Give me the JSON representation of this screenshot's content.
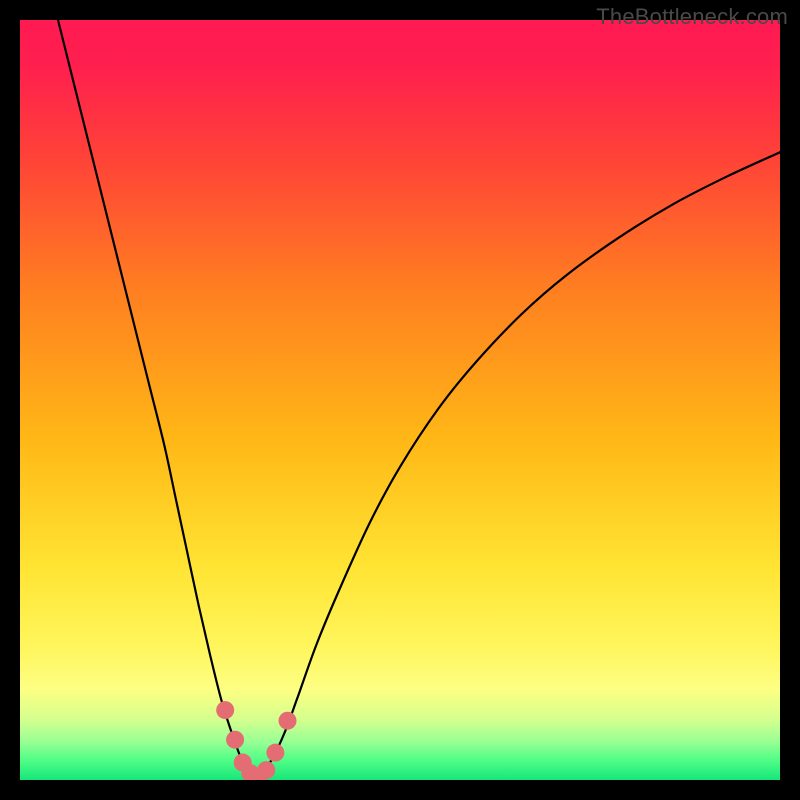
{
  "watermark": {
    "text": "TheBottleneck.com"
  },
  "chart_data": {
    "type": "line",
    "title": "",
    "xlabel": "",
    "ylabel": "",
    "xlim": [
      0,
      100
    ],
    "ylim": [
      0,
      100
    ],
    "grid": false,
    "legend": false,
    "background_gradient": {
      "stops": [
        {
          "pos": 0.0,
          "color": "#ff1a52"
        },
        {
          "pos": 0.06,
          "color": "#ff1f4f"
        },
        {
          "pos": 0.18,
          "color": "#ff4238"
        },
        {
          "pos": 0.35,
          "color": "#ff7d21"
        },
        {
          "pos": 0.55,
          "color": "#ffb716"
        },
        {
          "pos": 0.72,
          "color": "#ffe433"
        },
        {
          "pos": 0.82,
          "color": "#fff55a"
        },
        {
          "pos": 0.88,
          "color": "#fdff82"
        },
        {
          "pos": 0.92,
          "color": "#d5ff8e"
        },
        {
          "pos": 0.95,
          "color": "#97ff94"
        },
        {
          "pos": 0.975,
          "color": "#4dfd86"
        },
        {
          "pos": 1.0,
          "color": "#17e67a"
        }
      ]
    },
    "series": [
      {
        "name": "bottleneck-curve",
        "color": "#000000",
        "width": 2.2,
        "x": [
          5,
          7,
          9,
          11,
          13,
          15,
          17,
          19,
          20.5,
          22,
          23.5,
          25,
          26.5,
          28,
          29.2,
          30.2,
          31,
          31.8,
          33.2,
          34.8,
          36.5,
          39,
          42,
          46,
          50,
          55,
          60,
          66,
          72,
          79,
          86,
          93,
          100
        ],
        "y": [
          100,
          92,
          84,
          76,
          68,
          60,
          52,
          44,
          37,
          30,
          23,
          16.5,
          10.5,
          5.8,
          2.6,
          0.9,
          0.35,
          0.9,
          2.8,
          6.2,
          10.8,
          17.8,
          25,
          33.8,
          41.2,
          48.8,
          55,
          61.3,
          66.5,
          71.5,
          75.8,
          79.4,
          82.6
        ]
      }
    ],
    "markers": {
      "name": "bottleneck-dots",
      "color": "#e46d73",
      "radius": 9,
      "points": [
        {
          "x": 27.0,
          "y": 9.2
        },
        {
          "x": 28.3,
          "y": 5.3
        },
        {
          "x": 29.3,
          "y": 2.3
        },
        {
          "x": 30.3,
          "y": 0.9
        },
        {
          "x": 31.3,
          "y": 0.4
        },
        {
          "x": 32.4,
          "y": 1.3
        },
        {
          "x": 33.6,
          "y": 3.6
        },
        {
          "x": 35.2,
          "y": 7.8
        }
      ]
    }
  }
}
